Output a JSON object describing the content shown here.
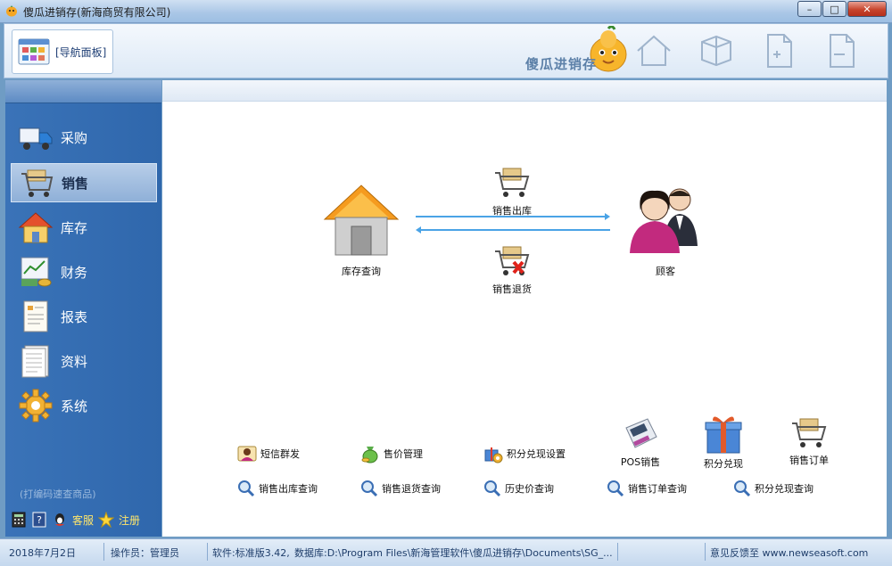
{
  "window": {
    "title": "傻瓜进销存(新海商贸有限公司)",
    "min_label": "–",
    "max_label": "□",
    "close_label": "✕"
  },
  "toolbar": {
    "nav_tab_label": "[导航面板]",
    "brand_text": "傻瓜进销存",
    "icons": [
      "home-icon",
      "cube-icon",
      "add-page-icon",
      "remove-page-icon"
    ]
  },
  "sidebar": {
    "items": [
      {
        "label": "采购",
        "icon": "truck-icon"
      },
      {
        "label": "销售",
        "icon": "cart-icon",
        "active": true
      },
      {
        "label": "库存",
        "icon": "warehouse-icon"
      },
      {
        "label": "财务",
        "icon": "finance-icon"
      },
      {
        "label": "报表",
        "icon": "report-icon"
      },
      {
        "label": "资料",
        "icon": "document-icon"
      },
      {
        "label": "系统",
        "icon": "gear-icon"
      }
    ],
    "hint": "(打编码速查商品)",
    "tools": {
      "service": "客服",
      "register": "注册"
    }
  },
  "flow": {
    "warehouse_label": "库存查询",
    "outbound_label": "销售出库",
    "return_label": "销售退货",
    "customer_label": "顾客"
  },
  "bottom": {
    "row1": [
      "短信群发",
      "售价管理",
      "积分兑现设置"
    ],
    "big": [
      "POS销售",
      "积分兑现",
      "销售订单"
    ],
    "row2": [
      "销售出库查询",
      "销售退货查询",
      "历史价查询",
      "销售订单查询",
      "积分兑现查询"
    ]
  },
  "status": {
    "date": "2018年7月2日",
    "operator": "操作员：管理员",
    "software": "软件:标准版3.42,",
    "database": "数据库:D:\\Program Files\\新海管理软件\\傻瓜进销存\\Documents\\SG_...",
    "feedback": "意见反馈至 www.newseasoft.com"
  },
  "colors": {
    "sidebar_bg": "#3570b4",
    "accent_blue": "#4aa3e6",
    "title_text": "#1a1a1a"
  }
}
